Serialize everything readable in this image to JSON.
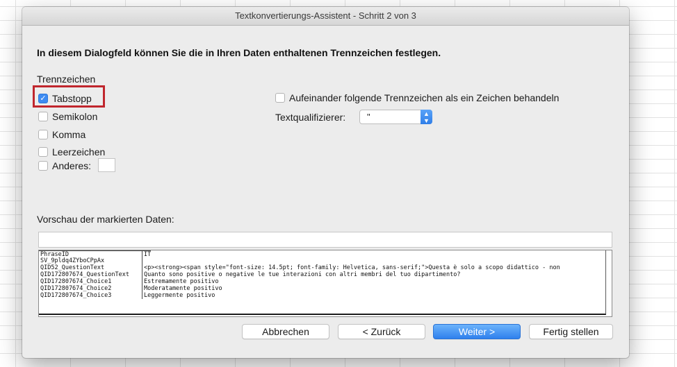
{
  "dialog": {
    "title": "Textkonvertierungs-Assistent - Schritt 2 von 3",
    "heading": "In diesem Dialogfeld können Sie die in Ihren Daten enthaltenen Trennzeichen festlegen."
  },
  "delimiters": {
    "group_label": "Trennzeichen",
    "items": [
      {
        "label": "Tabstopp",
        "checked": true
      },
      {
        "label": "Semikolon",
        "checked": false
      },
      {
        "label": "Komma",
        "checked": false
      },
      {
        "label": "Leerzeichen",
        "checked": false
      },
      {
        "label": "Anderes:",
        "checked": false
      }
    ],
    "other_value": ""
  },
  "options": {
    "consecutive_label": "Aufeinander folgende Trennzeichen als ein Zeichen behandeln",
    "consecutive_checked": false,
    "text_qualifier_label": "Textqualifizierer:",
    "text_qualifier_value": "\""
  },
  "preview": {
    "label": "Vorschau der markierten Daten:",
    "rows": [
      [
        "PhraseID",
        "IT"
      ],
      [
        "SV_9pldq4ZYboCPpAx",
        ""
      ],
      [
        "QID52_QuestionText",
        "<p><strong><span style=\"font-size: 14.5pt; font-family: Helvetica, sans-serif;\">Questa è  solo a scopo didattico - non"
      ],
      [
        "QID172807674_QuestionText",
        "Quanto sono positive o negative le tue interazioni con altri membri del tuo dipartimento?"
      ],
      [
        "QID172807674_Choice1",
        "Estremamente positivo"
      ],
      [
        "QID172807674_Choice2",
        "Moderatamente positivo"
      ],
      [
        "QID172807674_Choice3",
        "Leggermente positivo"
      ]
    ]
  },
  "buttons": {
    "cancel": "Abbrechen",
    "back": "< Zurück",
    "next": "Weiter >",
    "finish": "Fertig stellen"
  },
  "colors": {
    "accent": "#3d8bf2",
    "highlight_border": "#c0262d"
  },
  "icons": {
    "checkbox_checked": "checkmark-icon",
    "select_arrows": "up-down-chevron-icon"
  }
}
